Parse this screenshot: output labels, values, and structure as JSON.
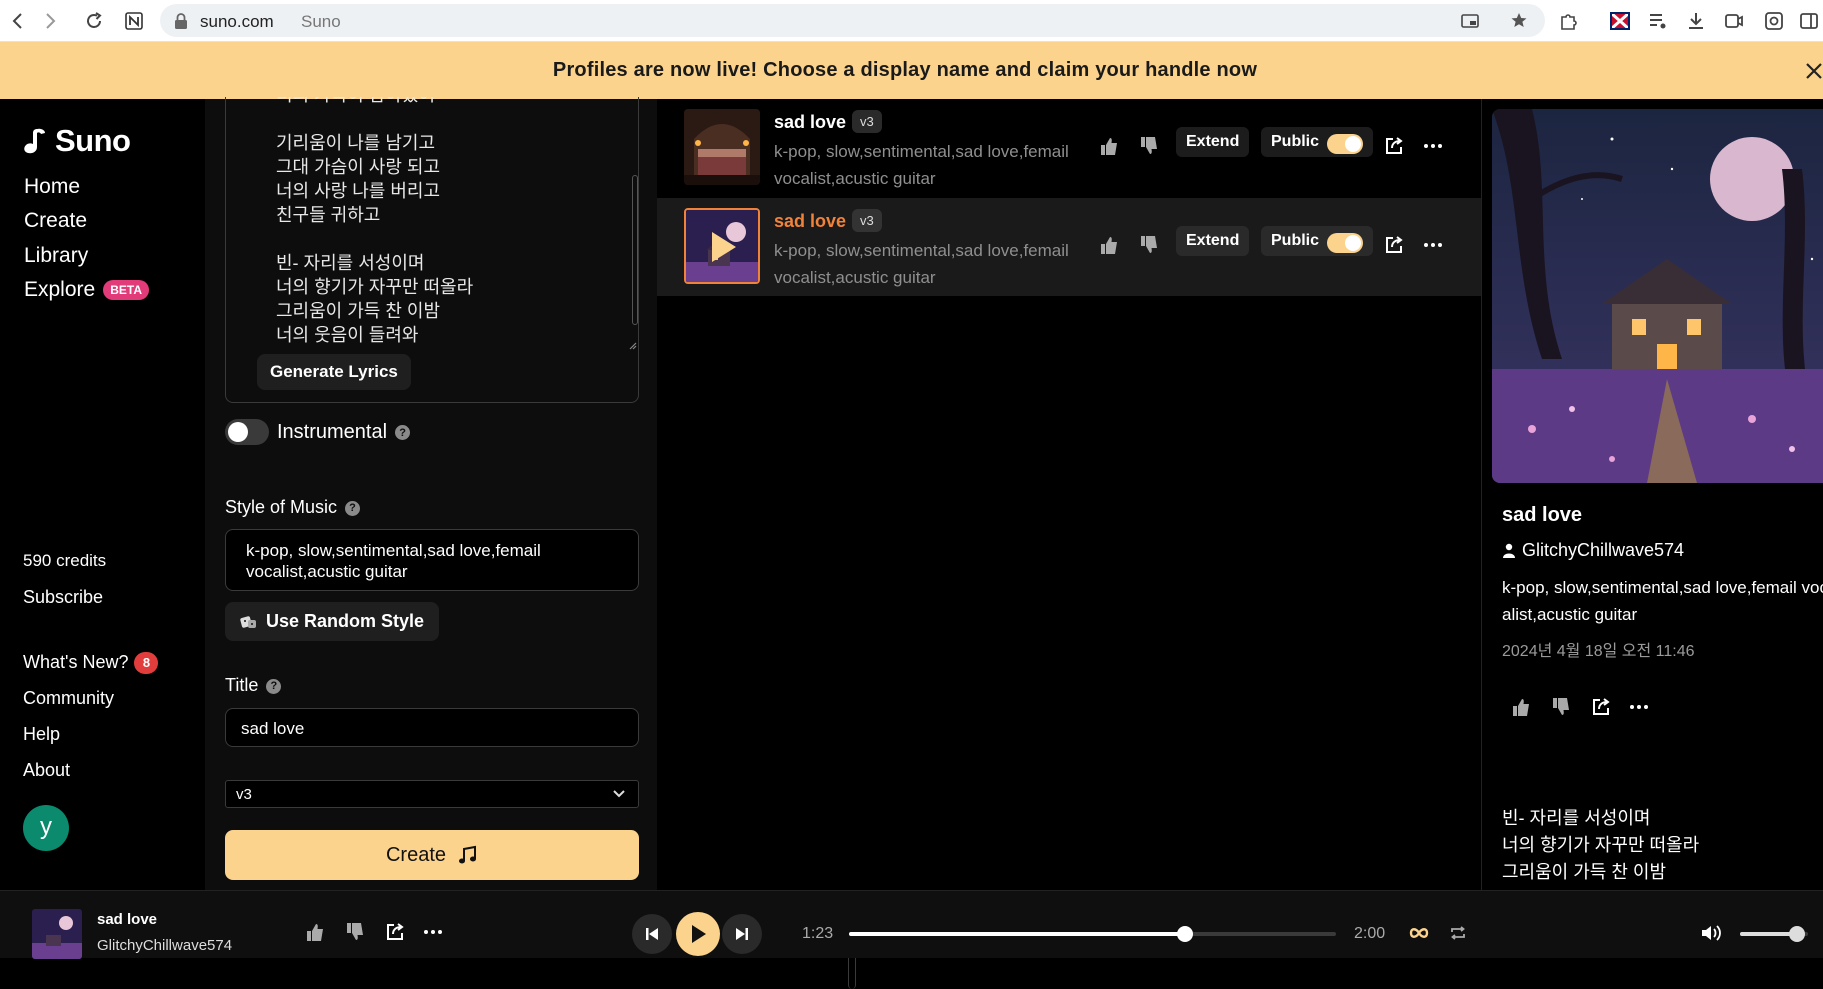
{
  "browser": {
    "domain": "suno.com",
    "tab_title": "Suno"
  },
  "banner": {
    "text": "Profiles are now live! Choose a display name and claim your handle now"
  },
  "sidebar": {
    "logo_text": "Suno",
    "nav": [
      {
        "label": "Home"
      },
      {
        "label": "Create"
      },
      {
        "label": "Library"
      },
      {
        "label": "Explore",
        "badge": "BETA"
      }
    ],
    "credits": "590 credits",
    "subscribe": "Subscribe",
    "whats_new": "What's New?",
    "whats_new_count": "8",
    "community": "Community",
    "help": "Help",
    "about": "About",
    "avatar_letter": "y"
  },
  "create": {
    "lyrics": "너의 가득이 남아있어\n\n기리움이 나를 남기고\n그대 가슴이 사랑 되고\n너의 사랑 나를 버리고\n친구들 귀하고\n\n빈- 자리를 서성이며\n너의 향기가 자꾸만 떠올라\n그리움이 가득 찬 이밤\n너의 웃음이 들려와",
    "generate_lyrics": "Generate Lyrics",
    "instrumental_label": "Instrumental",
    "style_label": "Style of Music",
    "style_value": "k-pop, slow,sentimental,sad love,femail vocalist,acustic guitar",
    "use_random_style": "Use Random Style",
    "title_label": "Title",
    "title_value": "sad love",
    "model_value": "v3",
    "create_button": "Create",
    "help_glyph": "?"
  },
  "songs": [
    {
      "title": "sad love",
      "version": "v3",
      "tags": "k-pop, slow,sentimental,sad love,femail vocalist,acustic guitar",
      "extend": "Extend",
      "visibility": "Public",
      "active": false
    },
    {
      "title": "sad love",
      "version": "v3",
      "tags": "k-pop, slow,sentimental,sad love,femail vocalist,acustic guitar",
      "extend": "Extend",
      "visibility": "Public",
      "active": true
    }
  ],
  "detail": {
    "title": "sad love",
    "user": "GlitchyChillwave574",
    "tags": "k-pop, slow,sentimental,sad love,femail vocalist,acustic guitar",
    "date": "2024년 4월 18일 오전 11:46",
    "lyrics_excerpt": "빈- 자리를 서성이며\n너의 향기가 자꾸만 떠올라\n그리움이 가득 찬 이밤"
  },
  "player": {
    "title": "sad love",
    "user": "GlitchyChillwave574",
    "current_time": "1:23",
    "total_time": "2:00",
    "progress_fraction": 0.69,
    "volume_fraction": 0.84
  },
  "colors": {
    "accent": "#fbd38d",
    "active_title": "#f0823a",
    "beta_badge": "#e13b7a",
    "notify_badge": "#e23d3d",
    "avatar_bg": "#0b8a6e"
  },
  "icons": [
    "back-icon",
    "forward-icon",
    "reload-icon",
    "lock-icon",
    "thumbs-up-icon",
    "thumbs-down-icon",
    "share-icon",
    "more-icon",
    "play-icon",
    "previous-icon",
    "next-icon",
    "loop-icon",
    "repeat-icon",
    "volume-icon",
    "music-note-icon",
    "dice-icon",
    "person-icon",
    "chevron-down-icon",
    "close-icon",
    "help-icon"
  ]
}
